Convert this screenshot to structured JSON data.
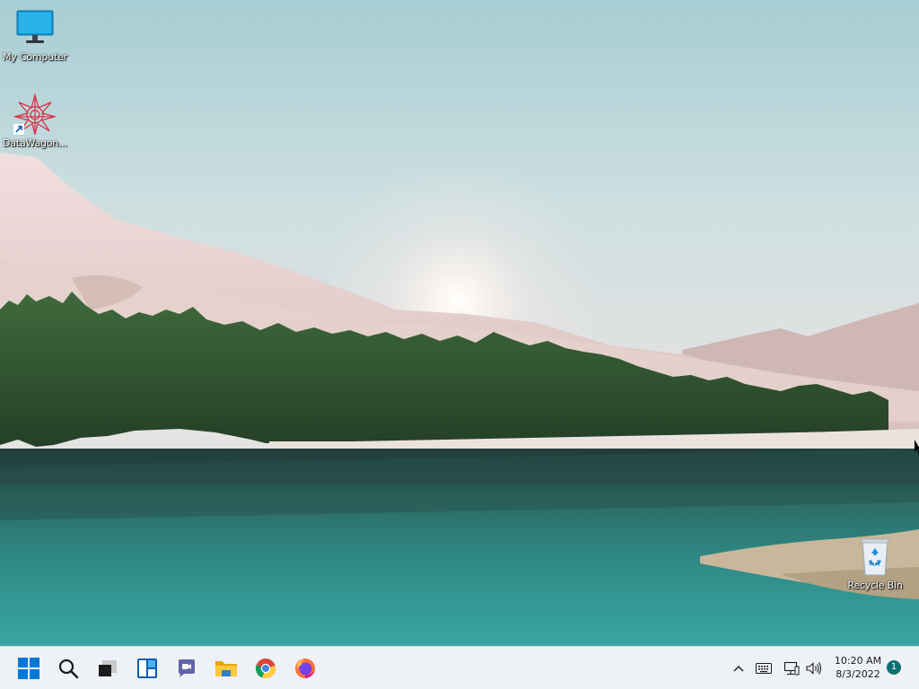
{
  "desktop": {
    "icons": [
      {
        "label": "My Computer",
        "icon": "monitor-icon"
      },
      {
        "label": "DataWagon...",
        "icon": "datawagon-app-icon",
        "shortcut": true
      },
      {
        "label": "Recycle Bin",
        "icon": "recycle-bin-icon"
      }
    ],
    "wallpaper": "lake-forest-mountains-sunrise"
  },
  "taskbar": {
    "buttons": [
      {
        "name": "start",
        "icon": "windows-logo-icon"
      },
      {
        "name": "search",
        "icon": "search-icon"
      },
      {
        "name": "task-view",
        "icon": "task-view-icon"
      },
      {
        "name": "widgets",
        "icon": "widgets-icon"
      },
      {
        "name": "chat",
        "icon": "teams-chat-icon"
      },
      {
        "name": "file-explorer",
        "icon": "folder-icon"
      },
      {
        "name": "chrome",
        "icon": "chrome-icon"
      },
      {
        "name": "firefox",
        "icon": "firefox-icon"
      }
    ],
    "tray": {
      "icons": [
        "chevron-up-icon",
        "keyboard-icon",
        "network-icon",
        "volume-icon"
      ],
      "time": "10:20 AM",
      "date": "8/3/2022",
      "notification_count": "1"
    }
  },
  "colors": {
    "taskbar_bg": "#eef1f5",
    "notification_badge": "#0e7070",
    "windows_blue": "#0078d4"
  }
}
